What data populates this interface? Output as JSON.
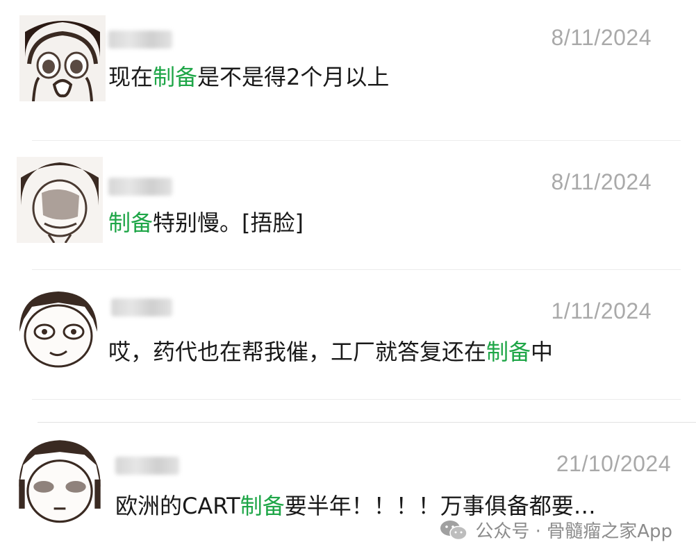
{
  "messages": [
    {
      "date": "8/11/2024",
      "parts": [
        {
          "t": "现在"
        },
        {
          "t": "制备",
          "hl": true
        },
        {
          "t": "是不是得2个月以上"
        }
      ]
    },
    {
      "date": "8/11/2024",
      "parts": [
        {
          "t": "制备",
          "hl": true
        },
        {
          "t": "特别慢。[捂脸]"
        }
      ]
    },
    {
      "date": "1/11/2024",
      "parts": [
        {
          "t": "哎，药代也在帮我催，工厂就答复还在"
        },
        {
          "t": "制备",
          "hl": true
        },
        {
          "t": "中"
        }
      ]
    },
    {
      "date": "21/10/2024",
      "parts": [
        {
          "t": "欧洲的CART"
        },
        {
          "t": "制备",
          "hl": true
        },
        {
          "t": "要半年！！！！万事俱备都要…"
        }
      ]
    }
  ],
  "watermark": {
    "icon": "wechat-icon",
    "text": "公众号 · 骨髓瘤之家App"
  },
  "colors": {
    "highlight": "#1fa648",
    "date": "#a9a9a9",
    "divider": "#ececec",
    "watermark": "#8c8c8c"
  }
}
